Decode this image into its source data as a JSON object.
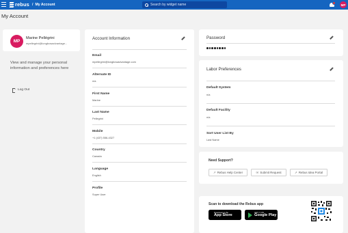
{
  "topbar": {
    "logo_text": "rebus",
    "breadcrumb_sep": "/",
    "breadcrumb_current": "My Account",
    "search_placeholder": "Search by widget name",
    "user_initials": "MP",
    "colors": {
      "bar": "#1565c0",
      "avatar": "#d81b60",
      "notification": "#e53935"
    }
  },
  "page": {
    "title": "My Account"
  },
  "profile": {
    "initials": "MP",
    "name": "Marine Pellégrini",
    "email": "mpellegrini@longbowadvantage...",
    "info_text": "View and manage your personal information and preferences here",
    "logout_label": "Log Out"
  },
  "account": {
    "heading": "Account Information",
    "fields": [
      {
        "label": "Email",
        "value": "mpellegrini@longbowadvantage.com"
      },
      {
        "label": "Alternate ID",
        "value": "n/a"
      },
      {
        "label": "First Name",
        "value": "Marine"
      },
      {
        "label": "Last Name",
        "value": "Pellegrini"
      },
      {
        "label": "Mobile",
        "value": "+1 (437) 556-4327"
      },
      {
        "label": "Country",
        "value": "Canada"
      },
      {
        "label": "Language",
        "value": "English"
      },
      {
        "label": "Profile",
        "value": "Super User"
      }
    ]
  },
  "password": {
    "heading": "Password",
    "masked_length": 8
  },
  "labor": {
    "heading": "Labor Preferences",
    "fields": [
      {
        "label": "Default System",
        "value": "n/a"
      },
      {
        "label": "Default Facility",
        "value": "n/a"
      },
      {
        "label": "Sort User List By",
        "value": "Last Name"
      }
    ]
  },
  "support": {
    "title": "Need Support?",
    "buttons": [
      {
        "label": "Rebus Help Center",
        "icon": "external-link-icon"
      },
      {
        "label": "Submit Request",
        "icon": "envelope-icon"
      },
      {
        "label": "Rebus Idea Portal",
        "icon": "lightbulb-icon"
      }
    ]
  },
  "download": {
    "title": "Scan to download the Rebus app",
    "app_store": {
      "small": "Download on the",
      "big": "App Store"
    },
    "google_play": {
      "small": "GET IT ON",
      "big": "Google Play"
    }
  }
}
